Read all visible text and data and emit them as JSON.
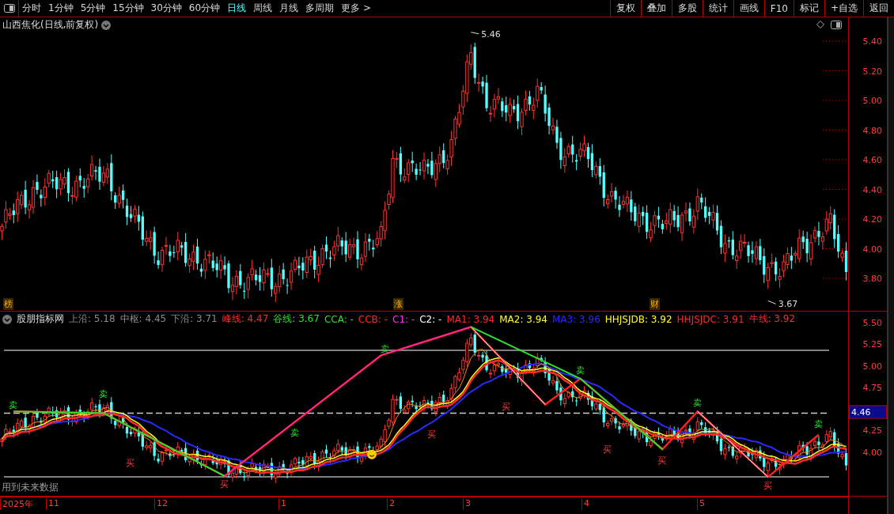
{
  "toolbar": {
    "periods": [
      {
        "label": "分时",
        "selected": false
      },
      {
        "label": "1分钟",
        "selected": false
      },
      {
        "label": "5分钟",
        "selected": false
      },
      {
        "label": "15分钟",
        "selected": false
      },
      {
        "label": "30分钟",
        "selected": false
      },
      {
        "label": "60分钟",
        "selected": false
      },
      {
        "label": "日线",
        "selected": true
      },
      {
        "label": "周线",
        "selected": false
      },
      {
        "label": "月线",
        "selected": false
      },
      {
        "label": "多周期",
        "selected": false
      },
      {
        "label": "更多 >",
        "selected": false
      }
    ],
    "actions": [
      "复权",
      "叠加",
      "多股",
      "统计",
      "画线",
      "F10",
      "标记",
      "+自选",
      "返回"
    ]
  },
  "main_chart": {
    "title": "山西焦化(日线,前复权)",
    "y_ticks": [
      "5.40",
      "5.20",
      "5.00",
      "4.80",
      "4.60",
      "4.40",
      "4.20",
      "4.00",
      "3.80"
    ],
    "high_label": "5.46",
    "low_label": "3.67",
    "event_markers": [
      {
        "label": "榜"
      },
      {
        "label": "涨"
      },
      {
        "label": "财"
      }
    ]
  },
  "indicator": {
    "title": "股朋指标网",
    "legend": [
      {
        "text": "上沿: 5.18",
        "color": "#8c8c8c"
      },
      {
        "text": "中枢: 4.45",
        "color": "#8c8c8c"
      },
      {
        "text": "下沿: 3.71",
        "color": "#8c8c8c"
      },
      {
        "text": "峰线: 4.47",
        "color": "#ff2a2a"
      },
      {
        "text": "谷线: 3.67",
        "color": "#2ee02e"
      },
      {
        "text": "CCA: -",
        "color": "#2ee02e"
      },
      {
        "text": "CCB: -",
        "color": "#ff2a2a"
      },
      {
        "text": "C1: -",
        "color": "#ff2aff"
      },
      {
        "text": "C2: -",
        "color": "#ffffff"
      },
      {
        "text": "MA1: 3.94",
        "color": "#ff2a2a"
      },
      {
        "text": "MA2: 3.94",
        "color": "#ffff2a"
      },
      {
        "text": "MA3: 3.96",
        "color": "#2a2aff"
      },
      {
        "text": "HHJSJDB: 3.92",
        "color": "#ffff2a"
      },
      {
        "text": "HHJSJDC: 3.91",
        "color": "#ff2a2a"
      },
      {
        "text": "牛线: 3.92",
        "color": "#ff2a2a"
      }
    ],
    "y_ticks": [
      {
        "label": "5.50",
        "current": false
      },
      {
        "label": "5.25",
        "current": false
      },
      {
        "label": "5.00",
        "current": false
      },
      {
        "label": "4.75",
        "current": false
      },
      {
        "label": "4.46",
        "current": true
      },
      {
        "label": "4.25",
        "current": false
      },
      {
        "label": "4.00",
        "current": false
      }
    ],
    "signals": [
      {
        "kind": "sell",
        "label": "卖"
      },
      {
        "kind": "sell",
        "label": "卖"
      },
      {
        "kind": "sell",
        "label": "卖"
      },
      {
        "kind": "sell",
        "label": "卖"
      },
      {
        "kind": "sell",
        "label": "卖"
      },
      {
        "kind": "sell",
        "label": "卖"
      },
      {
        "kind": "sell",
        "label": "卖"
      },
      {
        "kind": "buy",
        "label": "买"
      },
      {
        "kind": "buy",
        "label": "买"
      },
      {
        "kind": "buy",
        "label": "买"
      },
      {
        "kind": "buy",
        "label": "买"
      },
      {
        "kind": "buy",
        "label": "买"
      },
      {
        "kind": "buy",
        "label": "买"
      },
      {
        "kind": "buy",
        "label": "买"
      }
    ],
    "note": "用到未来数据"
  },
  "date_axis": [
    "2025年",
    "11",
    "12",
    "1",
    "2",
    "3",
    "4",
    "5"
  ]
}
